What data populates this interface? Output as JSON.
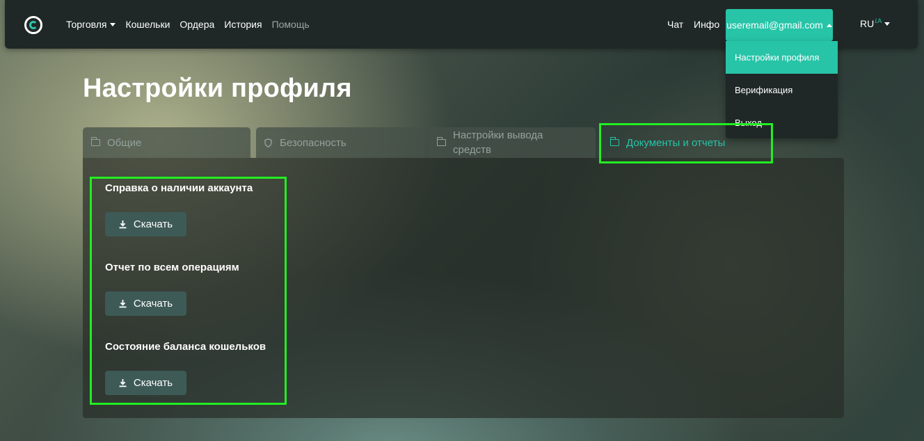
{
  "nav": {
    "items": [
      {
        "label": "Торговля",
        "dropdown": true
      },
      {
        "label": "Кошельки"
      },
      {
        "label": "Ордера"
      },
      {
        "label": "История"
      },
      {
        "label": "Помощь",
        "dim": true
      }
    ],
    "chat": "Чат",
    "info": "Инфо",
    "user_email": "useremail@gmail.com",
    "lang": "RU",
    "lang_icon": "translate-icon"
  },
  "dropdown": {
    "items": [
      {
        "label": "Настройки профиля",
        "active": true
      },
      {
        "label": "Верификация"
      },
      {
        "label": "Выход"
      }
    ]
  },
  "page": {
    "title": "Настройки профиля",
    "tabs": [
      {
        "label": "Общие",
        "icon": "folder-icon"
      },
      {
        "label": "Безопасность",
        "icon": "shield-icon"
      },
      {
        "label": "Настройки вывода средств",
        "icon": "folder-icon"
      },
      {
        "label": "Документы и отчеты",
        "icon": "folder-icon",
        "active": true
      }
    ],
    "documents": [
      {
        "title": "Справка о наличии аккаунта",
        "button": "Скачать"
      },
      {
        "title": "Отчет по всем операциям",
        "button": "Скачать"
      },
      {
        "title": "Состояние баланса кошельков",
        "button": "Скачать"
      }
    ]
  },
  "colors": {
    "accent": "#27c4a8",
    "highlight": "#22ee22",
    "bar": "#1f2826"
  }
}
